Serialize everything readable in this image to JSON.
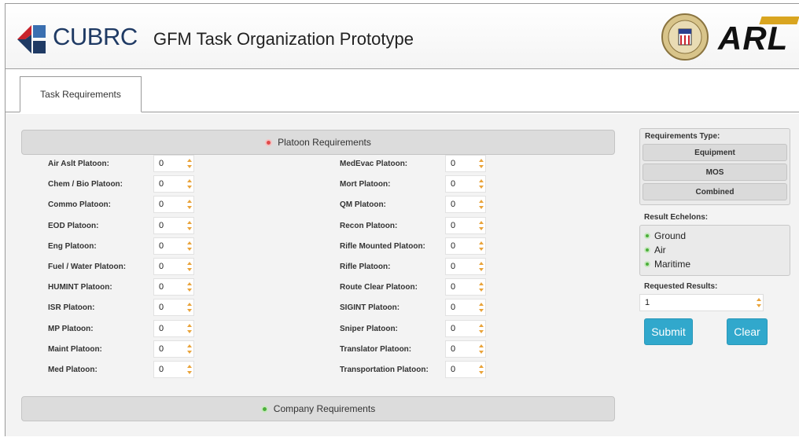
{
  "header": {
    "brand": "CUBRC",
    "title": "GFM Task Organization Prototype",
    "partner_logo_text": "ARL",
    "colors": {
      "brand_blue": "#1f3a64",
      "brand_red": "#c8232c",
      "arl_gold": "#d9a520"
    }
  },
  "tabs": [
    {
      "label": "Task Requirements",
      "active": true
    }
  ],
  "platoon_section": {
    "title": "Platoon Requirements",
    "state": "expanded",
    "icon": "minus-circle-icon"
  },
  "company_section": {
    "title": "Company Requirements",
    "state": "collapsed",
    "icon": "plus-circle-icon"
  },
  "platoons_left": [
    {
      "label": "Air Aslt Platoon:",
      "value": "0"
    },
    {
      "label": "Chem / Bio Platoon:",
      "value": "0"
    },
    {
      "label": "Commo Platoon:",
      "value": "0"
    },
    {
      "label": "EOD Platoon:",
      "value": "0"
    },
    {
      "label": "Eng Platoon:",
      "value": "0"
    },
    {
      "label": "Fuel / Water Platoon:",
      "value": "0"
    },
    {
      "label": "HUMINT Platoon:",
      "value": "0"
    },
    {
      "label": "ISR Platoon:",
      "value": "0"
    },
    {
      "label": "MP Platoon:",
      "value": "0"
    },
    {
      "label": "Maint Platoon:",
      "value": "0"
    },
    {
      "label": "Med Platoon:",
      "value": "0"
    }
  ],
  "platoons_right": [
    {
      "label": "MedEvac Platoon:",
      "value": "0"
    },
    {
      "label": "Mort Platoon:",
      "value": "0"
    },
    {
      "label": "QM Platoon:",
      "value": "0"
    },
    {
      "label": "Recon Platoon:",
      "value": "0"
    },
    {
      "label": "Rifle Mounted Platoon:",
      "value": "0"
    },
    {
      "label": "Rifle Platoon:",
      "value": "0"
    },
    {
      "label": "Route Clear Platoon:",
      "value": "0"
    },
    {
      "label": "SIGINT Platoon:",
      "value": "0"
    },
    {
      "label": "Sniper Platoon:",
      "value": "0"
    },
    {
      "label": "Translator Platoon:",
      "value": "0"
    },
    {
      "label": "Transportation Platoon:",
      "value": "0"
    }
  ],
  "sidebar": {
    "requirements_type_title": "Requirements Type:",
    "requirements_types": [
      "Equipment",
      "MOS",
      "Combined"
    ],
    "result_echelons_title": "Result Echelons:",
    "echelons": [
      "Ground",
      "Air",
      "Maritime"
    ],
    "requested_results_title": "Requested Results:",
    "requested_results_value": "1",
    "submit_label": "Submit",
    "clear_label": "Clear",
    "button_color": "#31a8cc"
  }
}
